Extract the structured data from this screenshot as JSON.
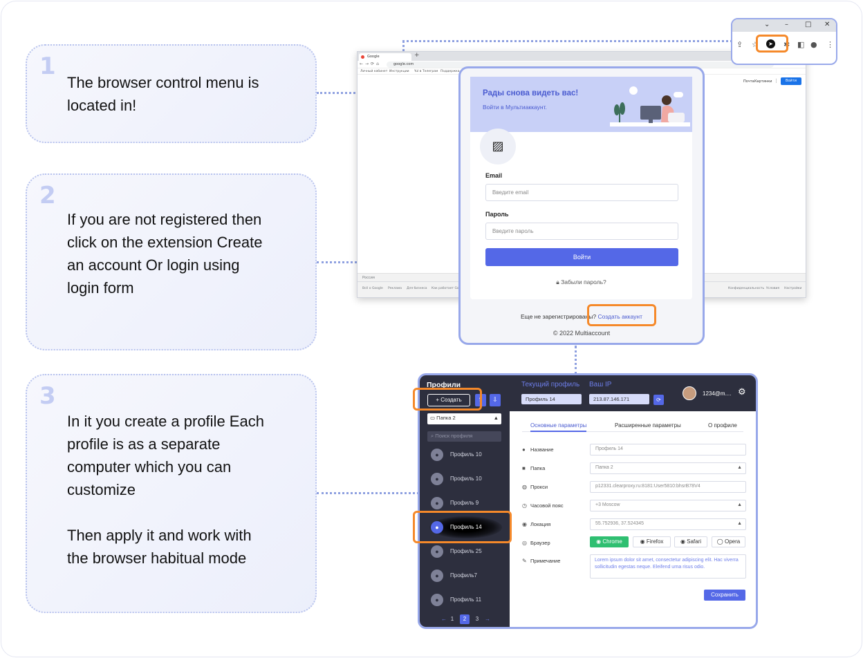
{
  "steps": [
    {
      "num": "1",
      "text": "The browser control menu is\n located in!"
    },
    {
      "num": "2",
      "text": "If you are not registered then\nclick on the extension Create\nan account Or login using\nlogin form"
    },
    {
      "num": "3",
      "text": "In it you create a profile Each\nprofile is as a separate\ncomputer which you can\ncustomize\n\nThen apply it and work with\nthe browser habitual mode"
    }
  ],
  "browser": {
    "tab_title": "Google",
    "url": "google.com",
    "bookmarks": [
      "Личный кабинет",
      "Инструкции",
      "Yul в Телеграм",
      "Поддержка"
    ],
    "top_links": [
      "Почта",
      "Картинки"
    ],
    "signin_label": "Войти",
    "footer_country": "Россия",
    "footer_links_left": [
      "Всё о Google",
      "Реклама",
      "Для бизнеса",
      "Как работает Google Поиск"
    ],
    "footer_links_right": [
      "Конфиденциальность",
      "Условия",
      "Настройки"
    ]
  },
  "popup": {
    "welcome": "Рады снова видеть вас!",
    "subtitle": "Войти в Мультиаккаунт.",
    "email_label": "Email",
    "email_placeholder": "Введите email",
    "password_label": "Пароль",
    "password_placeholder": "Введите пароль",
    "login_button": "Войти",
    "forgot": "Забыли пароль?",
    "not_registered": "Еще не зарегистрированы?",
    "create_account": "Создать аккаунт",
    "copyright": "© 2022 Multiaccount"
  },
  "app": {
    "sidebar_title": "Профили",
    "create_button": "Создать",
    "folder_select": "Папка 2",
    "search_placeholder": "Поиск профиля",
    "profiles": [
      "Профиль 10",
      "Профиль 10",
      "Профиль 9",
      "Профиль 14",
      "Профиль 25",
      "Профиль7",
      "Профиль 11"
    ],
    "active_profile_index": 3,
    "pages": [
      "1",
      "2",
      "3"
    ],
    "current_page": "2",
    "current_profile_label": "Текущий профиль",
    "current_profile_value": "Профиль 14",
    "ip_label": "Ваш IP",
    "ip_value": "213.87.146.171",
    "user_email": "1234@m....",
    "tabs": [
      "Основные параметры",
      "Расширенные параметры",
      "О профиле"
    ],
    "fields": [
      {
        "label": "Название",
        "value": "Профиль 14",
        "icon": "user-icon"
      },
      {
        "label": "Папка",
        "value": "Папка 2",
        "icon": "folder-icon"
      },
      {
        "label": "Прокси",
        "value": "p12331.clearproxy.ru:8181:User5810:bhsrB78V4",
        "icon": "globe-icon"
      },
      {
        "label": "Часовой пояс",
        "value": "+3 Moscow",
        "icon": "clock-icon"
      },
      {
        "label": "Локация",
        "value": "55.752936, 37.524345",
        "icon": "location-pin-icon"
      }
    ],
    "browser_label": "Браузер",
    "browsers": [
      "Chrome",
      "Firefox",
      "Safari",
      "Opera"
    ],
    "note_label": "Примечание",
    "note_text": "Lorem ipsum dolor sit amet, consectetur adipiscing elit. Hac viverra sollicitudin egestas neque. Eleifend urna risus odio.",
    "save_button": "Сохранить"
  }
}
